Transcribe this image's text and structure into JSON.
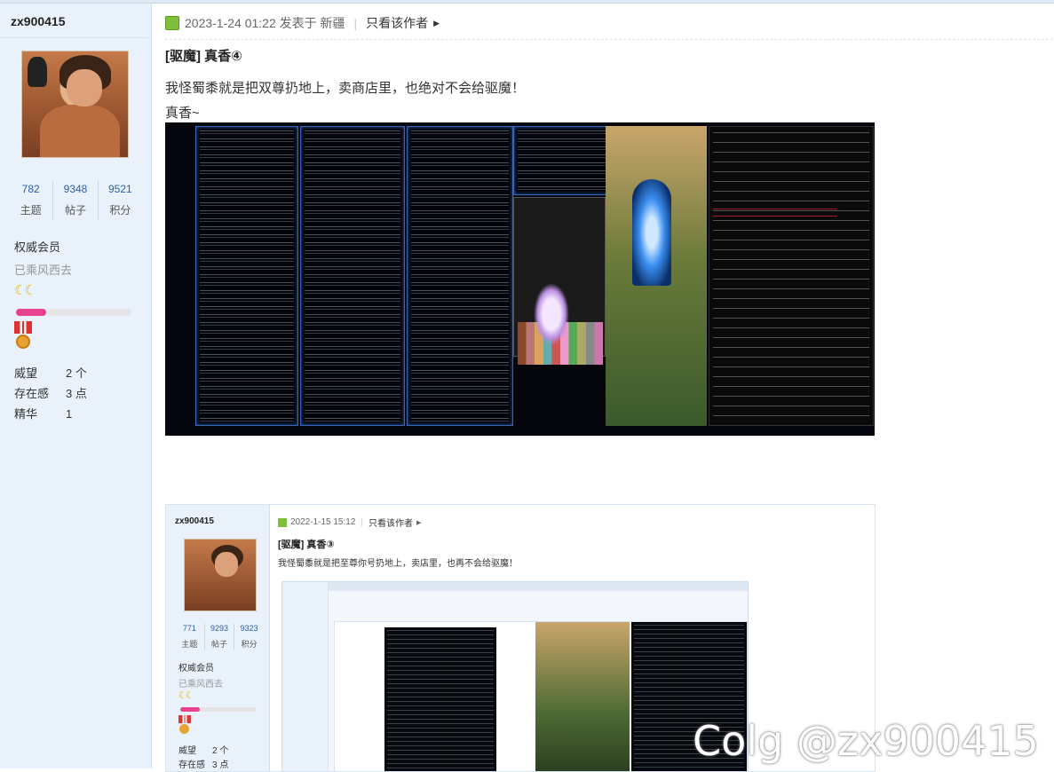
{
  "author": {
    "username": "zx900415",
    "stats": [
      {
        "value": "782",
        "label": "主题"
      },
      {
        "value": "9348",
        "label": "帖子"
      },
      {
        "value": "9521",
        "label": "积分"
      }
    ],
    "rank": "权威会员",
    "group": "已乘风西去",
    "level_icons": "☾☾",
    "progress": 0.26,
    "props": [
      {
        "label": "威望",
        "value": "2 个"
      },
      {
        "label": "存在感",
        "value": "3 点"
      },
      {
        "label": "精华",
        "value": "1"
      }
    ]
  },
  "post": {
    "meta": "2023-1-24 01:22 发表于 新疆",
    "author_only": "只看该作者",
    "title": "[驱魔] 真香④",
    "line1": "我怪蜀黍就是把双尊扔地上，卖商店里，也绝对不会给驱魔！",
    "line2": "真香~"
  },
  "embedded": {
    "username": "zx900415",
    "stats": [
      {
        "value": "771",
        "label": "主题"
      },
      {
        "value": "9293",
        "label": "帖子"
      },
      {
        "value": "9323",
        "label": "积分"
      }
    ],
    "rank": "权威会员",
    "group": "已乘风西去",
    "props": [
      {
        "label": "威望",
        "value": "2 个"
      },
      {
        "label": "存在感",
        "value": "3 点"
      }
    ],
    "meta_date": "2022-1-15 15:12",
    "author_only": "只看该作者",
    "title": "[驱魔] 真香③",
    "line1": "我怪蜀黍就是把至尊你号扔地上，卖店里，也再不会给驱魔！"
  },
  "watermark": "Colg @zx900415"
}
